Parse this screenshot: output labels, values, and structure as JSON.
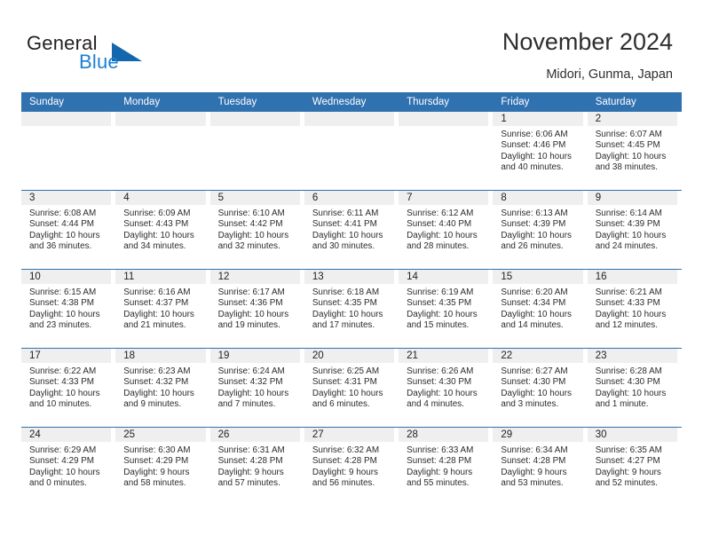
{
  "logo": {
    "word_top": "General",
    "word_bottom": "Blue",
    "triangle_color": "#1466ad",
    "blue_color": "#1b7fd4"
  },
  "header": {
    "title": "November 2024",
    "subtitle": "Midori, Gunma, Japan"
  },
  "theme": {
    "header_blue": "#3071b0",
    "daynum_gray": "#efefef",
    "text": "#222222"
  },
  "weekday_headers": [
    "Sunday",
    "Monday",
    "Tuesday",
    "Wednesday",
    "Thursday",
    "Friday",
    "Saturday"
  ],
  "labels": {
    "sunrise_prefix": "Sunrise:",
    "sunset_prefix": "Sunset:",
    "daylight_prefix": "Daylight:"
  },
  "weeks": [
    [
      {
        "day": "",
        "empty": true
      },
      {
        "day": "",
        "empty": true
      },
      {
        "day": "",
        "empty": true
      },
      {
        "day": "",
        "empty": true
      },
      {
        "day": "",
        "empty": true
      },
      {
        "day": "1",
        "sunrise": "Sunrise: 6:06 AM",
        "sunset": "Sunset: 4:46 PM",
        "daylight_l1": "Daylight: 10 hours",
        "daylight_l2": "and 40 minutes."
      },
      {
        "day": "2",
        "sunrise": "Sunrise: 6:07 AM",
        "sunset": "Sunset: 4:45 PM",
        "daylight_l1": "Daylight: 10 hours",
        "daylight_l2": "and 38 minutes."
      }
    ],
    [
      {
        "day": "3",
        "sunrise": "Sunrise: 6:08 AM",
        "sunset": "Sunset: 4:44 PM",
        "daylight_l1": "Daylight: 10 hours",
        "daylight_l2": "and 36 minutes."
      },
      {
        "day": "4",
        "sunrise": "Sunrise: 6:09 AM",
        "sunset": "Sunset: 4:43 PM",
        "daylight_l1": "Daylight: 10 hours",
        "daylight_l2": "and 34 minutes."
      },
      {
        "day": "5",
        "sunrise": "Sunrise: 6:10 AM",
        "sunset": "Sunset: 4:42 PM",
        "daylight_l1": "Daylight: 10 hours",
        "daylight_l2": "and 32 minutes."
      },
      {
        "day": "6",
        "sunrise": "Sunrise: 6:11 AM",
        "sunset": "Sunset: 4:41 PM",
        "daylight_l1": "Daylight: 10 hours",
        "daylight_l2": "and 30 minutes."
      },
      {
        "day": "7",
        "sunrise": "Sunrise: 6:12 AM",
        "sunset": "Sunset: 4:40 PM",
        "daylight_l1": "Daylight: 10 hours",
        "daylight_l2": "and 28 minutes."
      },
      {
        "day": "8",
        "sunrise": "Sunrise: 6:13 AM",
        "sunset": "Sunset: 4:39 PM",
        "daylight_l1": "Daylight: 10 hours",
        "daylight_l2": "and 26 minutes."
      },
      {
        "day": "9",
        "sunrise": "Sunrise: 6:14 AM",
        "sunset": "Sunset: 4:39 PM",
        "daylight_l1": "Daylight: 10 hours",
        "daylight_l2": "and 24 minutes."
      }
    ],
    [
      {
        "day": "10",
        "sunrise": "Sunrise: 6:15 AM",
        "sunset": "Sunset: 4:38 PM",
        "daylight_l1": "Daylight: 10 hours",
        "daylight_l2": "and 23 minutes."
      },
      {
        "day": "11",
        "sunrise": "Sunrise: 6:16 AM",
        "sunset": "Sunset: 4:37 PM",
        "daylight_l1": "Daylight: 10 hours",
        "daylight_l2": "and 21 minutes."
      },
      {
        "day": "12",
        "sunrise": "Sunrise: 6:17 AM",
        "sunset": "Sunset: 4:36 PM",
        "daylight_l1": "Daylight: 10 hours",
        "daylight_l2": "and 19 minutes."
      },
      {
        "day": "13",
        "sunrise": "Sunrise: 6:18 AM",
        "sunset": "Sunset: 4:35 PM",
        "daylight_l1": "Daylight: 10 hours",
        "daylight_l2": "and 17 minutes."
      },
      {
        "day": "14",
        "sunrise": "Sunrise: 6:19 AM",
        "sunset": "Sunset: 4:35 PM",
        "daylight_l1": "Daylight: 10 hours",
        "daylight_l2": "and 15 minutes."
      },
      {
        "day": "15",
        "sunrise": "Sunrise: 6:20 AM",
        "sunset": "Sunset: 4:34 PM",
        "daylight_l1": "Daylight: 10 hours",
        "daylight_l2": "and 14 minutes."
      },
      {
        "day": "16",
        "sunrise": "Sunrise: 6:21 AM",
        "sunset": "Sunset: 4:33 PM",
        "daylight_l1": "Daylight: 10 hours",
        "daylight_l2": "and 12 minutes."
      }
    ],
    [
      {
        "day": "17",
        "sunrise": "Sunrise: 6:22 AM",
        "sunset": "Sunset: 4:33 PM",
        "daylight_l1": "Daylight: 10 hours",
        "daylight_l2": "and 10 minutes."
      },
      {
        "day": "18",
        "sunrise": "Sunrise: 6:23 AM",
        "sunset": "Sunset: 4:32 PM",
        "daylight_l1": "Daylight: 10 hours",
        "daylight_l2": "and 9 minutes."
      },
      {
        "day": "19",
        "sunrise": "Sunrise: 6:24 AM",
        "sunset": "Sunset: 4:32 PM",
        "daylight_l1": "Daylight: 10 hours",
        "daylight_l2": "and 7 minutes."
      },
      {
        "day": "20",
        "sunrise": "Sunrise: 6:25 AM",
        "sunset": "Sunset: 4:31 PM",
        "daylight_l1": "Daylight: 10 hours",
        "daylight_l2": "and 6 minutes."
      },
      {
        "day": "21",
        "sunrise": "Sunrise: 6:26 AM",
        "sunset": "Sunset: 4:30 PM",
        "daylight_l1": "Daylight: 10 hours",
        "daylight_l2": "and 4 minutes."
      },
      {
        "day": "22",
        "sunrise": "Sunrise: 6:27 AM",
        "sunset": "Sunset: 4:30 PM",
        "daylight_l1": "Daylight: 10 hours",
        "daylight_l2": "and 3 minutes."
      },
      {
        "day": "23",
        "sunrise": "Sunrise: 6:28 AM",
        "sunset": "Sunset: 4:30 PM",
        "daylight_l1": "Daylight: 10 hours",
        "daylight_l2": "and 1 minute."
      }
    ],
    [
      {
        "day": "24",
        "sunrise": "Sunrise: 6:29 AM",
        "sunset": "Sunset: 4:29 PM",
        "daylight_l1": "Daylight: 10 hours",
        "daylight_l2": "and 0 minutes."
      },
      {
        "day": "25",
        "sunrise": "Sunrise: 6:30 AM",
        "sunset": "Sunset: 4:29 PM",
        "daylight_l1": "Daylight: 9 hours",
        "daylight_l2": "and 58 minutes."
      },
      {
        "day": "26",
        "sunrise": "Sunrise: 6:31 AM",
        "sunset": "Sunset: 4:28 PM",
        "daylight_l1": "Daylight: 9 hours",
        "daylight_l2": "and 57 minutes."
      },
      {
        "day": "27",
        "sunrise": "Sunrise: 6:32 AM",
        "sunset": "Sunset: 4:28 PM",
        "daylight_l1": "Daylight: 9 hours",
        "daylight_l2": "and 56 minutes."
      },
      {
        "day": "28",
        "sunrise": "Sunrise: 6:33 AM",
        "sunset": "Sunset: 4:28 PM",
        "daylight_l1": "Daylight: 9 hours",
        "daylight_l2": "and 55 minutes."
      },
      {
        "day": "29",
        "sunrise": "Sunrise: 6:34 AM",
        "sunset": "Sunset: 4:28 PM",
        "daylight_l1": "Daylight: 9 hours",
        "daylight_l2": "and 53 minutes."
      },
      {
        "day": "30",
        "sunrise": "Sunrise: 6:35 AM",
        "sunset": "Sunset: 4:27 PM",
        "daylight_l1": "Daylight: 9 hours",
        "daylight_l2": "and 52 minutes."
      }
    ]
  ]
}
